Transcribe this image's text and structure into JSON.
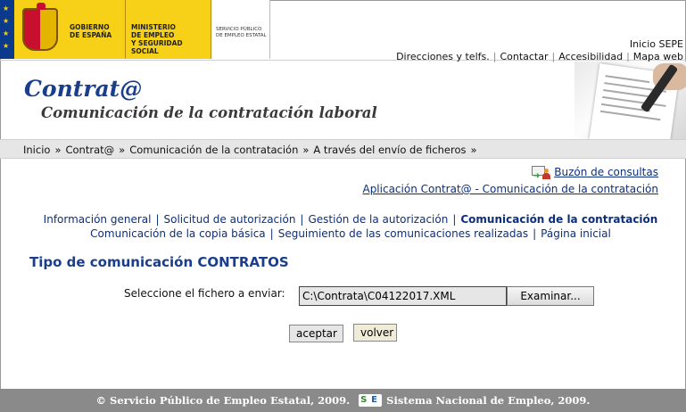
{
  "gov": {
    "gobierno_line1": "GOBIERNO",
    "gobierno_line2": "DE ESPAÑA",
    "ministerio_line1": "MINISTERIO",
    "ministerio_line2": "DE EMPLEO",
    "ministerio_line3": "Y SEGURIDAD SOCIAL",
    "sepe_line1": "SERVICIO PÚBLICO",
    "sepe_line2": "DE EMPLEO ESTATAL"
  },
  "top_links": {
    "inicio_sepe": "Inicio SEPE",
    "items": [
      "Direcciones y telfs.",
      "Contactar",
      "Accesibilidad",
      "Mapa web"
    ]
  },
  "header": {
    "app_name": "Contrat@",
    "subtitle": "Comunicación de la contratación laboral"
  },
  "breadcrumb": [
    "Inicio",
    "Contrat@",
    "Comunicación de la contratación",
    "A través del envío de ficheros"
  ],
  "breadcrumb_sep": "»",
  "right_links": {
    "buzon": "Buzón de consultas",
    "app_link": "Aplicación Contrat@ - Comunicación de la contratación"
  },
  "nav": {
    "row1": [
      "Información general",
      "Solicitud de autorización",
      "Gestión de la autorización",
      "Comunicación de la contratación"
    ],
    "row2": [
      "Comunicación de la copia básica",
      "Seguimiento de las comunicaciones realizadas",
      "Página inicial"
    ],
    "separator": "|"
  },
  "section_title": "Tipo de comunicación CONTRATOS",
  "form": {
    "file_label": "Seleccione el fichero a enviar:",
    "file_value": "C:\\Contrata\\C04122017.XML",
    "browse_label": "Examinar...",
    "accept_label": "aceptar",
    "back_label": "volver"
  },
  "footer": {
    "left": "© Servicio Público de Empleo Estatal, 2009.",
    "copy_symbol": "©",
    "right": "Sistema Nacional de Empleo, 2009.",
    "logo_s": "S",
    "logo_e": "E"
  },
  "colors": {
    "brand_blue": "#1a3e8c",
    "link_blue": "#0d2f7a",
    "gov_yellow": "#f7d117",
    "footer_gray": "#8a8a8a"
  }
}
